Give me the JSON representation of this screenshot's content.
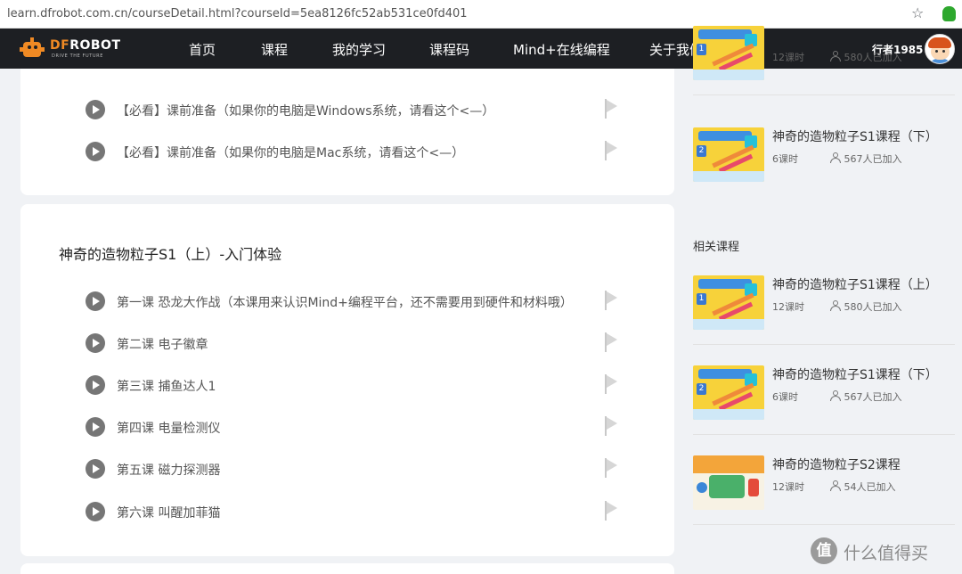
{
  "browser": {
    "url": "learn.dfrobot.com.cn/courseDetail.html?courseId=5ea8126fc52ab531ce0fd401",
    "star_icon": "star-icon",
    "extension_icon": "evernote-icon"
  },
  "nav": {
    "logo_text_a": "DF",
    "logo_text_b": "ROBOT",
    "logo_tagline": "DRIVE THE FUTURE",
    "items": [
      "首页",
      "课程",
      "我的学习",
      "课程码",
      "Mind+在线编程",
      "关于我们"
    ],
    "username": "行者1985"
  },
  "prep_section": {
    "lessons": [
      "【必看】课前准备（如果你的电脑是Windows系统，请看这个<—）",
      "【必看】课前准备（如果你的电脑是Mac系统，请看这个<—）"
    ]
  },
  "course_section": {
    "title": "神奇的造物粒子S1（上）-入门体验",
    "lessons": [
      "第一课 恐龙大作战（本课用来认识Mind+编程平台，还不需要用到硬件和材料哦）",
      "第二课 电子徽章",
      "第三课 捕鱼达人1",
      "第四课 电量检测仪",
      "第五课 磁力探测器",
      "第六课 叫醒加菲猫"
    ]
  },
  "sidebar": {
    "top_items": [
      {
        "name": "",
        "hours": "12课时",
        "joined": "580人已加入",
        "badge": "1"
      },
      {
        "name": "神奇的造物粒子S1课程（下）",
        "hours": "6课时",
        "joined": "567人已加入",
        "badge": "2"
      }
    ],
    "related_label": "相关课程",
    "related": [
      {
        "name": "神奇的造物粒子S1课程（上）",
        "hours": "12课时",
        "joined": "580人已加入",
        "badge": "1"
      },
      {
        "name": "神奇的造物粒子S1课程（下）",
        "hours": "6课时",
        "joined": "567人已加入",
        "badge": "2"
      },
      {
        "name": "神奇的造物粒子S2课程",
        "hours": "12课时",
        "joined": "54人已加入"
      }
    ]
  },
  "watermark": {
    "glyph": "值",
    "text": "什么值得买"
  }
}
